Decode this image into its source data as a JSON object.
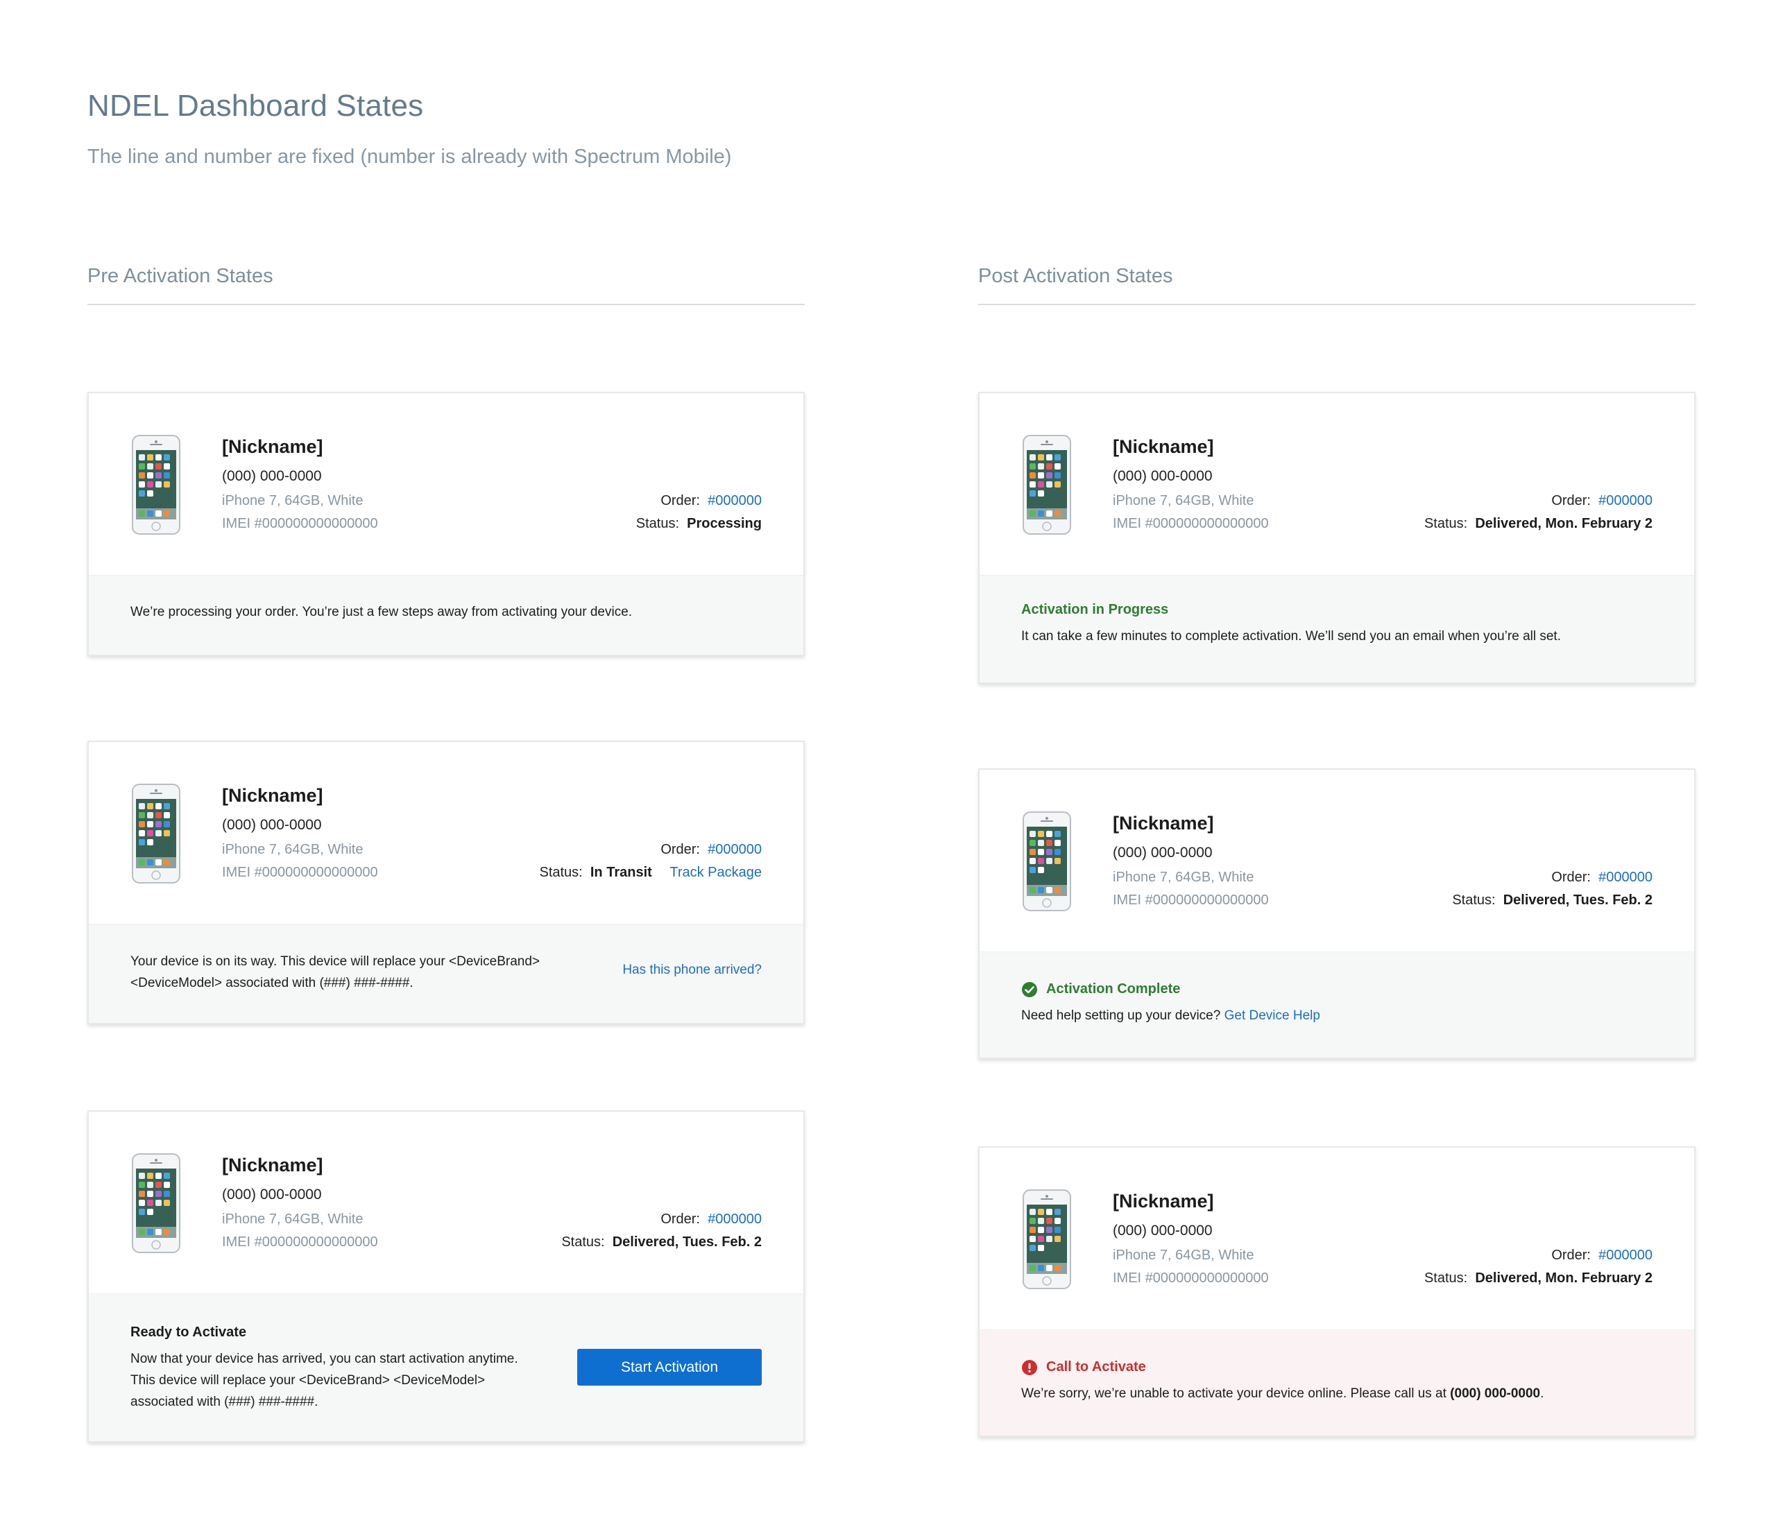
{
  "header": {
    "title": "NDEL Dashboard States",
    "subtitle": "The line and number are fixed (number is already with Spectrum Mobile)"
  },
  "sections": {
    "pre": "Pre Activation States",
    "post": "Post Activation States"
  },
  "colors": {
    "accent": "#1a6fc2",
    "button": "#0f6fd0",
    "success": "#2e7d32",
    "error": "#cf2d2d"
  },
  "cards": [
    {
      "nickname": "[Nickname]",
      "number": "(000) 000-0000",
      "model": "iPhone 7, 64GB, White",
      "imei": "IMEI #000000000000000",
      "order_label": "Order:",
      "order_value": "#000000",
      "status_label": "Status:",
      "status_value": "Processing",
      "message": "We’re processing your order. You’re just a few steps away from activating your device."
    },
    {
      "nickname": "[Nickname]",
      "number": "(000) 000-0000",
      "model": "iPhone 7, 64GB, White",
      "imei": "IMEI #000000000000000",
      "order_label": "Order:",
      "order_value": "#000000",
      "status_label": "Status:",
      "status_value": "In Transit",
      "track_link": "Track Package",
      "message_line1": "Your device is on its way. This device will replace your <DeviceBrand>",
      "message_line2": "<DeviceModel> associated with (###) ###-####.",
      "arrived_link": "Has this phone arrived?"
    },
    {
      "nickname": "[Nickname]",
      "number": "(000) 000-0000",
      "model": "iPhone 7, 64GB, White",
      "imei": "IMEI #000000000000000",
      "order_label": "Order:",
      "order_value": "#000000",
      "status_label": "Status:",
      "status_value": "Delivered, Tues. Feb. 2",
      "state_title": "Ready to Activate",
      "message_line1": "Now that your device has arrived, you can start activation anytime.",
      "message_line2": "This device will replace your <DeviceBrand> <DeviceModel>",
      "message_line3": "associated with (###) ###-####.",
      "button_label": "Start Activation"
    },
    {
      "nickname": "[Nickname]",
      "number": "(000) 000-0000",
      "model": "iPhone 7, 64GB, White",
      "imei": "IMEI #000000000000000",
      "order_label": "Order:",
      "order_value": "#000000",
      "status_label": "Status:",
      "status_value": "Delivered, Mon. February 2",
      "state_title": "Activation in Progress",
      "message": "It can take a few minutes to complete activation. We’ll send you an email when you’re all set."
    },
    {
      "nickname": "[Nickname]",
      "number": "(000) 000-0000",
      "model": "iPhone 7, 64GB, White",
      "imei": "IMEI #000000000000000",
      "order_label": "Order:",
      "order_value": "#000000",
      "status_label": "Status:",
      "status_value": "Delivered, Tues. Feb. 2",
      "state_title": "Activation Complete",
      "state_icon": "check-circle-icon",
      "message": "Need help setting up your device?",
      "help_link": "Get Device Help"
    },
    {
      "nickname": "[Nickname]",
      "number": "(000) 000-0000",
      "model": "iPhone 7, 64GB, White",
      "imei": "IMEI #000000000000000",
      "order_label": "Order:",
      "order_value": "#000000",
      "status_label": "Status:",
      "status_value": "Delivered, Mon. February 2",
      "state_title": "Call to Activate",
      "state_icon": "alert-circle-icon",
      "message": "We’re sorry, we’re unable to activate your device online. Please call us at",
      "call_number": "(000) 000-0000",
      "message_end": "."
    }
  ]
}
